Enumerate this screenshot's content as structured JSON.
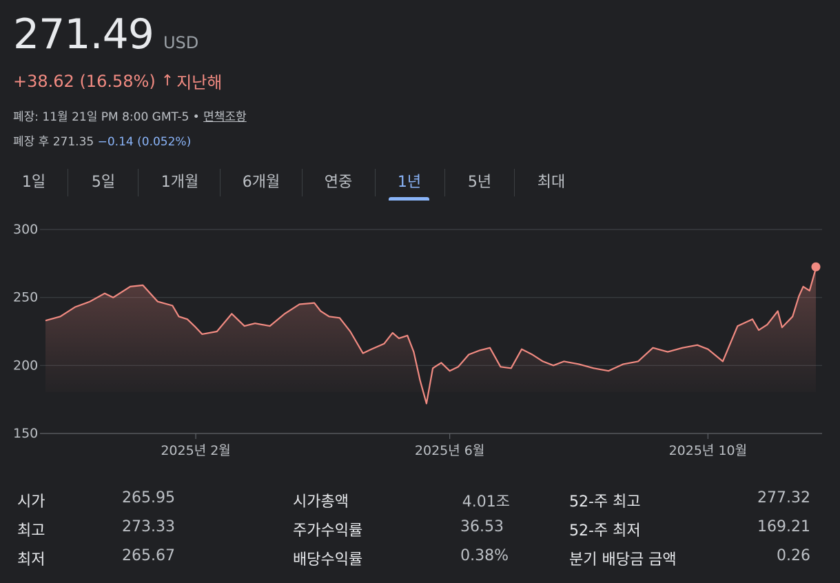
{
  "quote": {
    "price": "271.49",
    "currency": "USD",
    "change": "+38.62 (16.58%)",
    "change_arrow": "↑",
    "change_period": "지난해",
    "close_prefix": "폐장: 11월 21일 PM 8:00 GMT-5 •",
    "disclaimer": "면책조항",
    "after_hours_label": "폐장 후 271.35",
    "after_hours_change": "−0.14 (0.052%)"
  },
  "colors": {
    "background": "#202124",
    "line": "#f28b82",
    "positive": "#f28b82",
    "negative_blue": "#8ab4f8",
    "active_tab": "#8ab4f8"
  },
  "tabs": [
    {
      "label": "1일",
      "active": false
    },
    {
      "label": "5일",
      "active": false
    },
    {
      "label": "1개월",
      "active": false
    },
    {
      "label": "6개월",
      "active": false
    },
    {
      "label": "연중",
      "active": false
    },
    {
      "label": "1년",
      "active": true
    },
    {
      "label": "5년",
      "active": false
    },
    {
      "label": "최대",
      "active": false
    }
  ],
  "chart_data": {
    "type": "area",
    "x_range": [
      "2024-11-22",
      "2025-11-21"
    ],
    "ylim": [
      150,
      300
    ],
    "y_ticks": [
      300,
      250,
      200,
      150
    ],
    "x_ticks": [
      {
        "date": "2025-02-01",
        "label": "2025년 2월"
      },
      {
        "date": "2025-06-01",
        "label": "2025년 6월"
      },
      {
        "date": "2025-10-01",
        "label": "2025년 10월"
      }
    ],
    "grid": true,
    "series": [
      {
        "points": [
          [
            "2024-11-22",
            233
          ],
          [
            "2024-11-29",
            236
          ],
          [
            "2024-12-06",
            243
          ],
          [
            "2024-12-13",
            247
          ],
          [
            "2024-12-20",
            253
          ],
          [
            "2024-12-24",
            250
          ],
          [
            "2025-01-01",
            258
          ],
          [
            "2025-01-07",
            259
          ],
          [
            "2025-01-14",
            247
          ],
          [
            "2025-01-21",
            244
          ],
          [
            "2025-01-24",
            236
          ],
          [
            "2025-01-28",
            234
          ],
          [
            "2025-02-01",
            228
          ],
          [
            "2025-02-04",
            223
          ],
          [
            "2025-02-11",
            225
          ],
          [
            "2025-02-18",
            238
          ],
          [
            "2025-02-24",
            229
          ],
          [
            "2025-03-01",
            231
          ],
          [
            "2025-03-08",
            229
          ],
          [
            "2025-03-15",
            238
          ],
          [
            "2025-03-22",
            245
          ],
          [
            "2025-03-29",
            246
          ],
          [
            "2025-04-01",
            240
          ],
          [
            "2025-04-05",
            236
          ],
          [
            "2025-04-10",
            235
          ],
          [
            "2025-04-15",
            225
          ],
          [
            "2025-04-21",
            209
          ],
          [
            "2025-04-25",
            212
          ],
          [
            "2025-05-01",
            216
          ],
          [
            "2025-05-05",
            224
          ],
          [
            "2025-05-08",
            220
          ],
          [
            "2025-05-12",
            222
          ],
          [
            "2025-05-15",
            210
          ],
          [
            "2025-05-18",
            189
          ],
          [
            "2025-05-21",
            172
          ],
          [
            "2025-05-24",
            198
          ],
          [
            "2025-05-28",
            202
          ],
          [
            "2025-06-01",
            196
          ],
          [
            "2025-06-05",
            199
          ],
          [
            "2025-06-10",
            208
          ],
          [
            "2025-06-15",
            211
          ],
          [
            "2025-06-20",
            213
          ],
          [
            "2025-06-25",
            199
          ],
          [
            "2025-06-30",
            198
          ],
          [
            "2025-07-05",
            212
          ],
          [
            "2025-07-10",
            208
          ],
          [
            "2025-07-15",
            203
          ],
          [
            "2025-07-20",
            200
          ],
          [
            "2025-07-25",
            203
          ],
          [
            "2025-08-01",
            201
          ],
          [
            "2025-08-08",
            198
          ],
          [
            "2025-08-15",
            196
          ],
          [
            "2025-08-22",
            201
          ],
          [
            "2025-08-29",
            203
          ],
          [
            "2025-09-05",
            213
          ],
          [
            "2025-09-12",
            210
          ],
          [
            "2025-09-19",
            213
          ],
          [
            "2025-09-26",
            215
          ],
          [
            "2025-10-01",
            212
          ],
          [
            "2025-10-08",
            203
          ],
          [
            "2025-10-15",
            229
          ],
          [
            "2025-10-22",
            234
          ],
          [
            "2025-10-25",
            226
          ],
          [
            "2025-10-29",
            230
          ],
          [
            "2025-11-01",
            236
          ],
          [
            "2025-11-03",
            240
          ],
          [
            "2025-11-05",
            228
          ],
          [
            "2025-11-10",
            236
          ],
          [
            "2025-11-13",
            251
          ],
          [
            "2025-11-15",
            258
          ],
          [
            "2025-11-18",
            255
          ],
          [
            "2025-11-21",
            271.49
          ]
        ]
      }
    ]
  },
  "stats": [
    {
      "label": "시가",
      "value": "265.95"
    },
    {
      "label": "최고",
      "value": "273.33"
    },
    {
      "label": "최저",
      "value": "265.67"
    },
    {
      "label": "시가총액",
      "value": "4.01조"
    },
    {
      "label": "주가수익률",
      "value": "36.53"
    },
    {
      "label": "배당수익률",
      "value": "0.38%"
    },
    {
      "label": "52-주 최고",
      "value": "277.32"
    },
    {
      "label": "52-주 최저",
      "value": "169.21"
    },
    {
      "label": "분기 배당금 금액",
      "value": "0.26"
    }
  ]
}
